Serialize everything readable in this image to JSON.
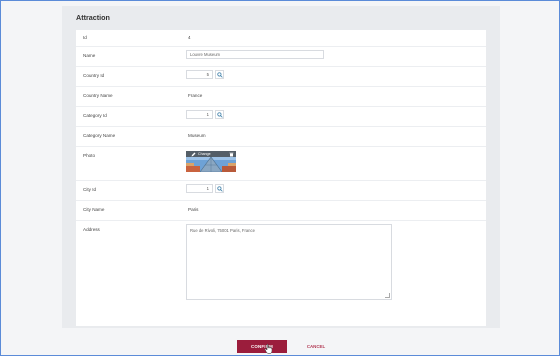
{
  "panel": {
    "title": "Attraction"
  },
  "fields": {
    "id": {
      "label": "Id",
      "value": "4"
    },
    "name": {
      "label": "Name",
      "value": "Louvre Museum"
    },
    "country_id": {
      "label": "Country Id",
      "value": "5"
    },
    "country_name": {
      "label": "Country Name",
      "value": "France"
    },
    "category_id": {
      "label": "Category Id",
      "value": "1"
    },
    "category_name": {
      "label": "Category Name",
      "value": "Museum"
    },
    "photo": {
      "label": "Photo",
      "change_label": "Change"
    },
    "city_id": {
      "label": "City Id",
      "value": "1"
    },
    "city_name": {
      "label": "City Name",
      "value": "Paris"
    },
    "address": {
      "label": "Address",
      "value": "Rue de Rivoli, 75001 Paris, France"
    }
  },
  "actions": {
    "confirm": "CONFIRM",
    "cancel": "CANCEL"
  },
  "icons": {
    "lookup": "search-icon",
    "edit": "pencil-icon",
    "delete": "trash-icon"
  },
  "colors": {
    "primary": "#9b1d3c",
    "cancel_text": "#b23a55",
    "frame_border": "#5b8bd8"
  }
}
